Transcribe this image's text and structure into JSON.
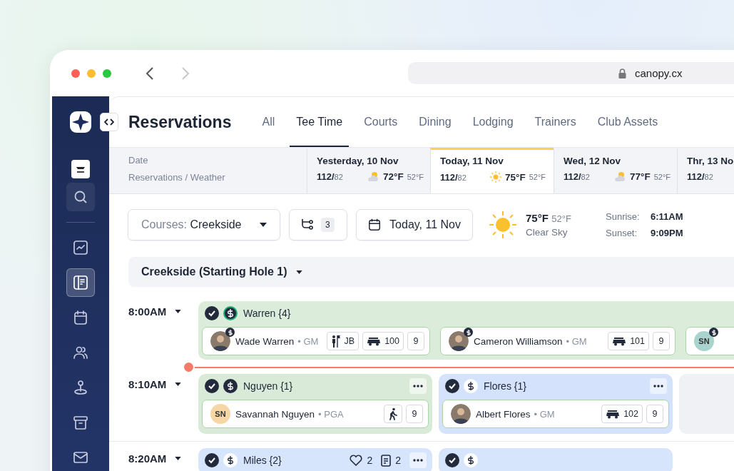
{
  "browser": {
    "url": "canopy.cx",
    "back_enabled": true,
    "forward_enabled": false
  },
  "sidebar": {
    "items": [
      {
        "kind": "analytics",
        "selected": false
      },
      {
        "kind": "reservations",
        "selected": true
      },
      {
        "kind": "calendar",
        "selected": false
      },
      {
        "kind": "members",
        "selected": false
      },
      {
        "kind": "location",
        "selected": false
      },
      {
        "kind": "archive",
        "selected": false
      },
      {
        "kind": "mail",
        "selected": false
      }
    ]
  },
  "header": {
    "title": "Reservations",
    "tabs": [
      {
        "label": "All",
        "selected": false
      },
      {
        "label": "Tee Time",
        "selected": true
      },
      {
        "label": "Courts",
        "selected": false
      },
      {
        "label": "Dining",
        "selected": false
      },
      {
        "label": "Lodging",
        "selected": false
      },
      {
        "label": "Trainers",
        "selected": false
      },
      {
        "label": "Club Assets",
        "selected": false
      }
    ]
  },
  "date_strip": {
    "label": "Date",
    "sublabel": "Reservations / Weather",
    "days": [
      {
        "label": "Yesterday, 10 Nov",
        "booked": "112/",
        "capacity": "82",
        "weather": {
          "kind": "partly_cloudy"
        },
        "high": "72°F",
        "low": "52°F",
        "selected": false
      },
      {
        "label": "Today, 11 Nov",
        "booked": "112/",
        "capacity": "82",
        "weather": {
          "kind": "sunny"
        },
        "high": "75°F",
        "low": "52°F",
        "selected": true
      },
      {
        "label": "Wed, 12 Nov",
        "booked": "112/",
        "capacity": "82",
        "weather": {
          "kind": "partly_cloudy"
        },
        "high": "77°F",
        "low": "52°F",
        "selected": false
      },
      {
        "label": "Thr, 13 No",
        "booked": "112/",
        "capacity": "82",
        "selected": false
      }
    ]
  },
  "toolbar": {
    "course_label": "Courses:",
    "course_value": "Creekside",
    "split_count": "3",
    "date": "Today, 11 Nov",
    "weather": {
      "high": "75°F",
      "low": "52°F",
      "condition": "Clear Sky",
      "sunrise_label": "Sunrise:",
      "sunrise": "6:11AM",
      "sunset_label": "Sunset:",
      "sunset": "9:09PM"
    }
  },
  "course_header": "Creekside (Starting Hole 1)",
  "slots": [
    {
      "time": "8:00AM",
      "now_line_after": true,
      "groups": [
        {
          "kind": "booking",
          "name": "Warren {4}",
          "color": "#dcecdb",
          "checked": true,
          "paid": true,
          "highlighted": true,
          "menu": false,
          "wide": true,
          "players": [
            {
              "name": "Wade Warren",
              "role": "• GM",
              "photo": true,
              "paid": true,
              "tags": [
                {
                  "kind": "caddie",
                  "text": "JB"
                },
                {
                  "kind": "cart",
                  "text": "100"
                }
              ],
              "holes": "9"
            },
            {
              "name": "Cameron Williamson",
              "role": "• GM",
              "photo": true,
              "paid": true,
              "tags": [
                {
                  "kind": "cart",
                  "text": "101"
                }
              ],
              "holes": "9"
            },
            {
              "photo": false,
              "initials": "SN",
              "color": "#a9d4cd",
              "paid": true
            }
          ]
        }
      ]
    },
    {
      "time": "8:10AM",
      "now_line_after": false,
      "groups": [
        {
          "kind": "booking",
          "name": "Nguyen {1}",
          "color": "#d9ebd8",
          "checked": true,
          "paid": true,
          "highlighted": false,
          "menu": true,
          "wide": false,
          "players": [
            {
              "name": "Savannah Nguyen",
              "role": "• PGA",
              "photo": false,
              "initials": "SN",
              "color": "#f7d6a6",
              "paid": false,
              "tags": [
                {
                  "kind": "walking"
                }
              ],
              "holes": "9"
            }
          ]
        },
        {
          "kind": "booking",
          "name": "Flores {1}",
          "color": "#d4e2fb",
          "checked": true,
          "paid": false,
          "highlighted": false,
          "menu": true,
          "wide": false,
          "players": [
            {
              "name": "Albert Flores",
              "role": "• GM",
              "photo": true,
              "paid": false,
              "tags": [
                {
                  "kind": "cart",
                  "text": "102"
                }
              ],
              "holes": "9"
            }
          ]
        },
        {
          "kind": "empty"
        }
      ]
    },
    {
      "time": "8:20AM",
      "now_line_after": false,
      "groups": [
        {
          "kind": "booking",
          "name": "Miles {2}",
          "color": "#d6e4fc",
          "checked": true,
          "paid": false,
          "highlighted": false,
          "menu": true,
          "wide": false,
          "likes": "2",
          "notes": "2"
        },
        {
          "kind": "booking",
          "color": "#d6e4fc",
          "checked": true,
          "paid": false,
          "highlighted": false,
          "menu": false,
          "wide": false
        }
      ]
    }
  ]
}
